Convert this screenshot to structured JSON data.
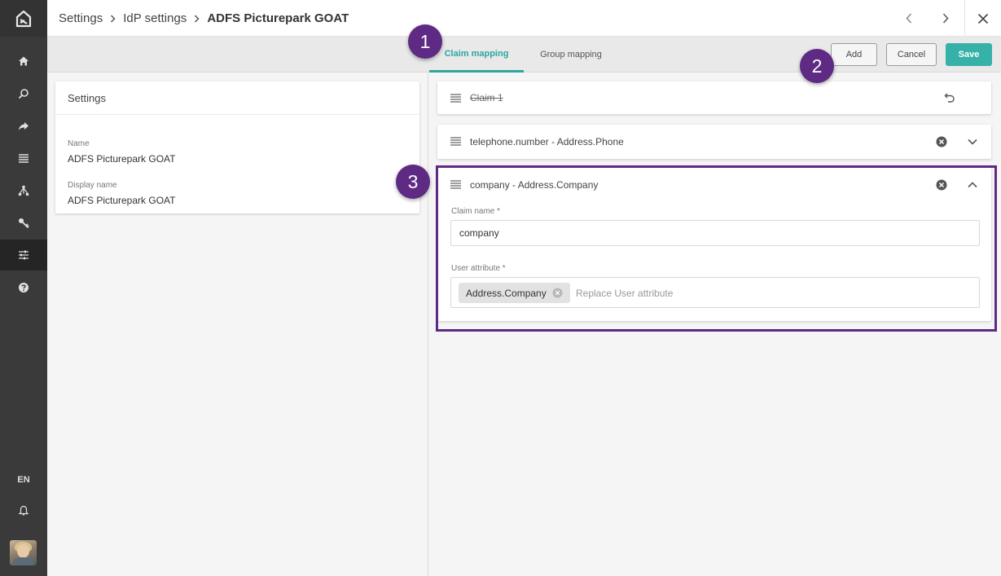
{
  "breadcrumb": {
    "items": [
      "Settings",
      "IdP settings"
    ],
    "current": "ADFS Picturepark GOAT"
  },
  "rail": {
    "language": "EN",
    "items": [
      "home-icon",
      "search-icon",
      "share-icon",
      "list-icon",
      "hierarchy-icon",
      "key-icon",
      "settings-sliders-icon",
      "help-icon"
    ],
    "active_item": "settings-sliders-icon"
  },
  "tabs": [
    {
      "label": "Claim mapping",
      "active": true
    },
    {
      "label": "Group mapping",
      "active": false
    }
  ],
  "toolbar": {
    "add_label": "Add",
    "cancel_label": "Cancel",
    "save_label": "Save"
  },
  "settings_card": {
    "title": "Settings",
    "fields": [
      {
        "label": "Name",
        "value": "ADFS Picturepark GOAT"
      },
      {
        "label": "Display name",
        "value": "ADFS Picturepark GOAT"
      }
    ]
  },
  "claims": [
    {
      "title": "Claim 1",
      "state": "deleted"
    },
    {
      "title": "telephone.number - Address.Phone",
      "state": "collapsed"
    },
    {
      "title": "company - Address.Company",
      "state": "expanded",
      "claim_name_label": "Claim name *",
      "claim_name_value": "company",
      "user_attribute_label": "User attribute *",
      "user_attribute_chip": "Address.Company",
      "user_attribute_placeholder": "Replace User attribute"
    }
  ],
  "badges": [
    "1",
    "2",
    "3"
  ],
  "colors": {
    "accent": "#35b1a8",
    "callout": "#5e2a84",
    "rail": "#3a3a3a"
  }
}
